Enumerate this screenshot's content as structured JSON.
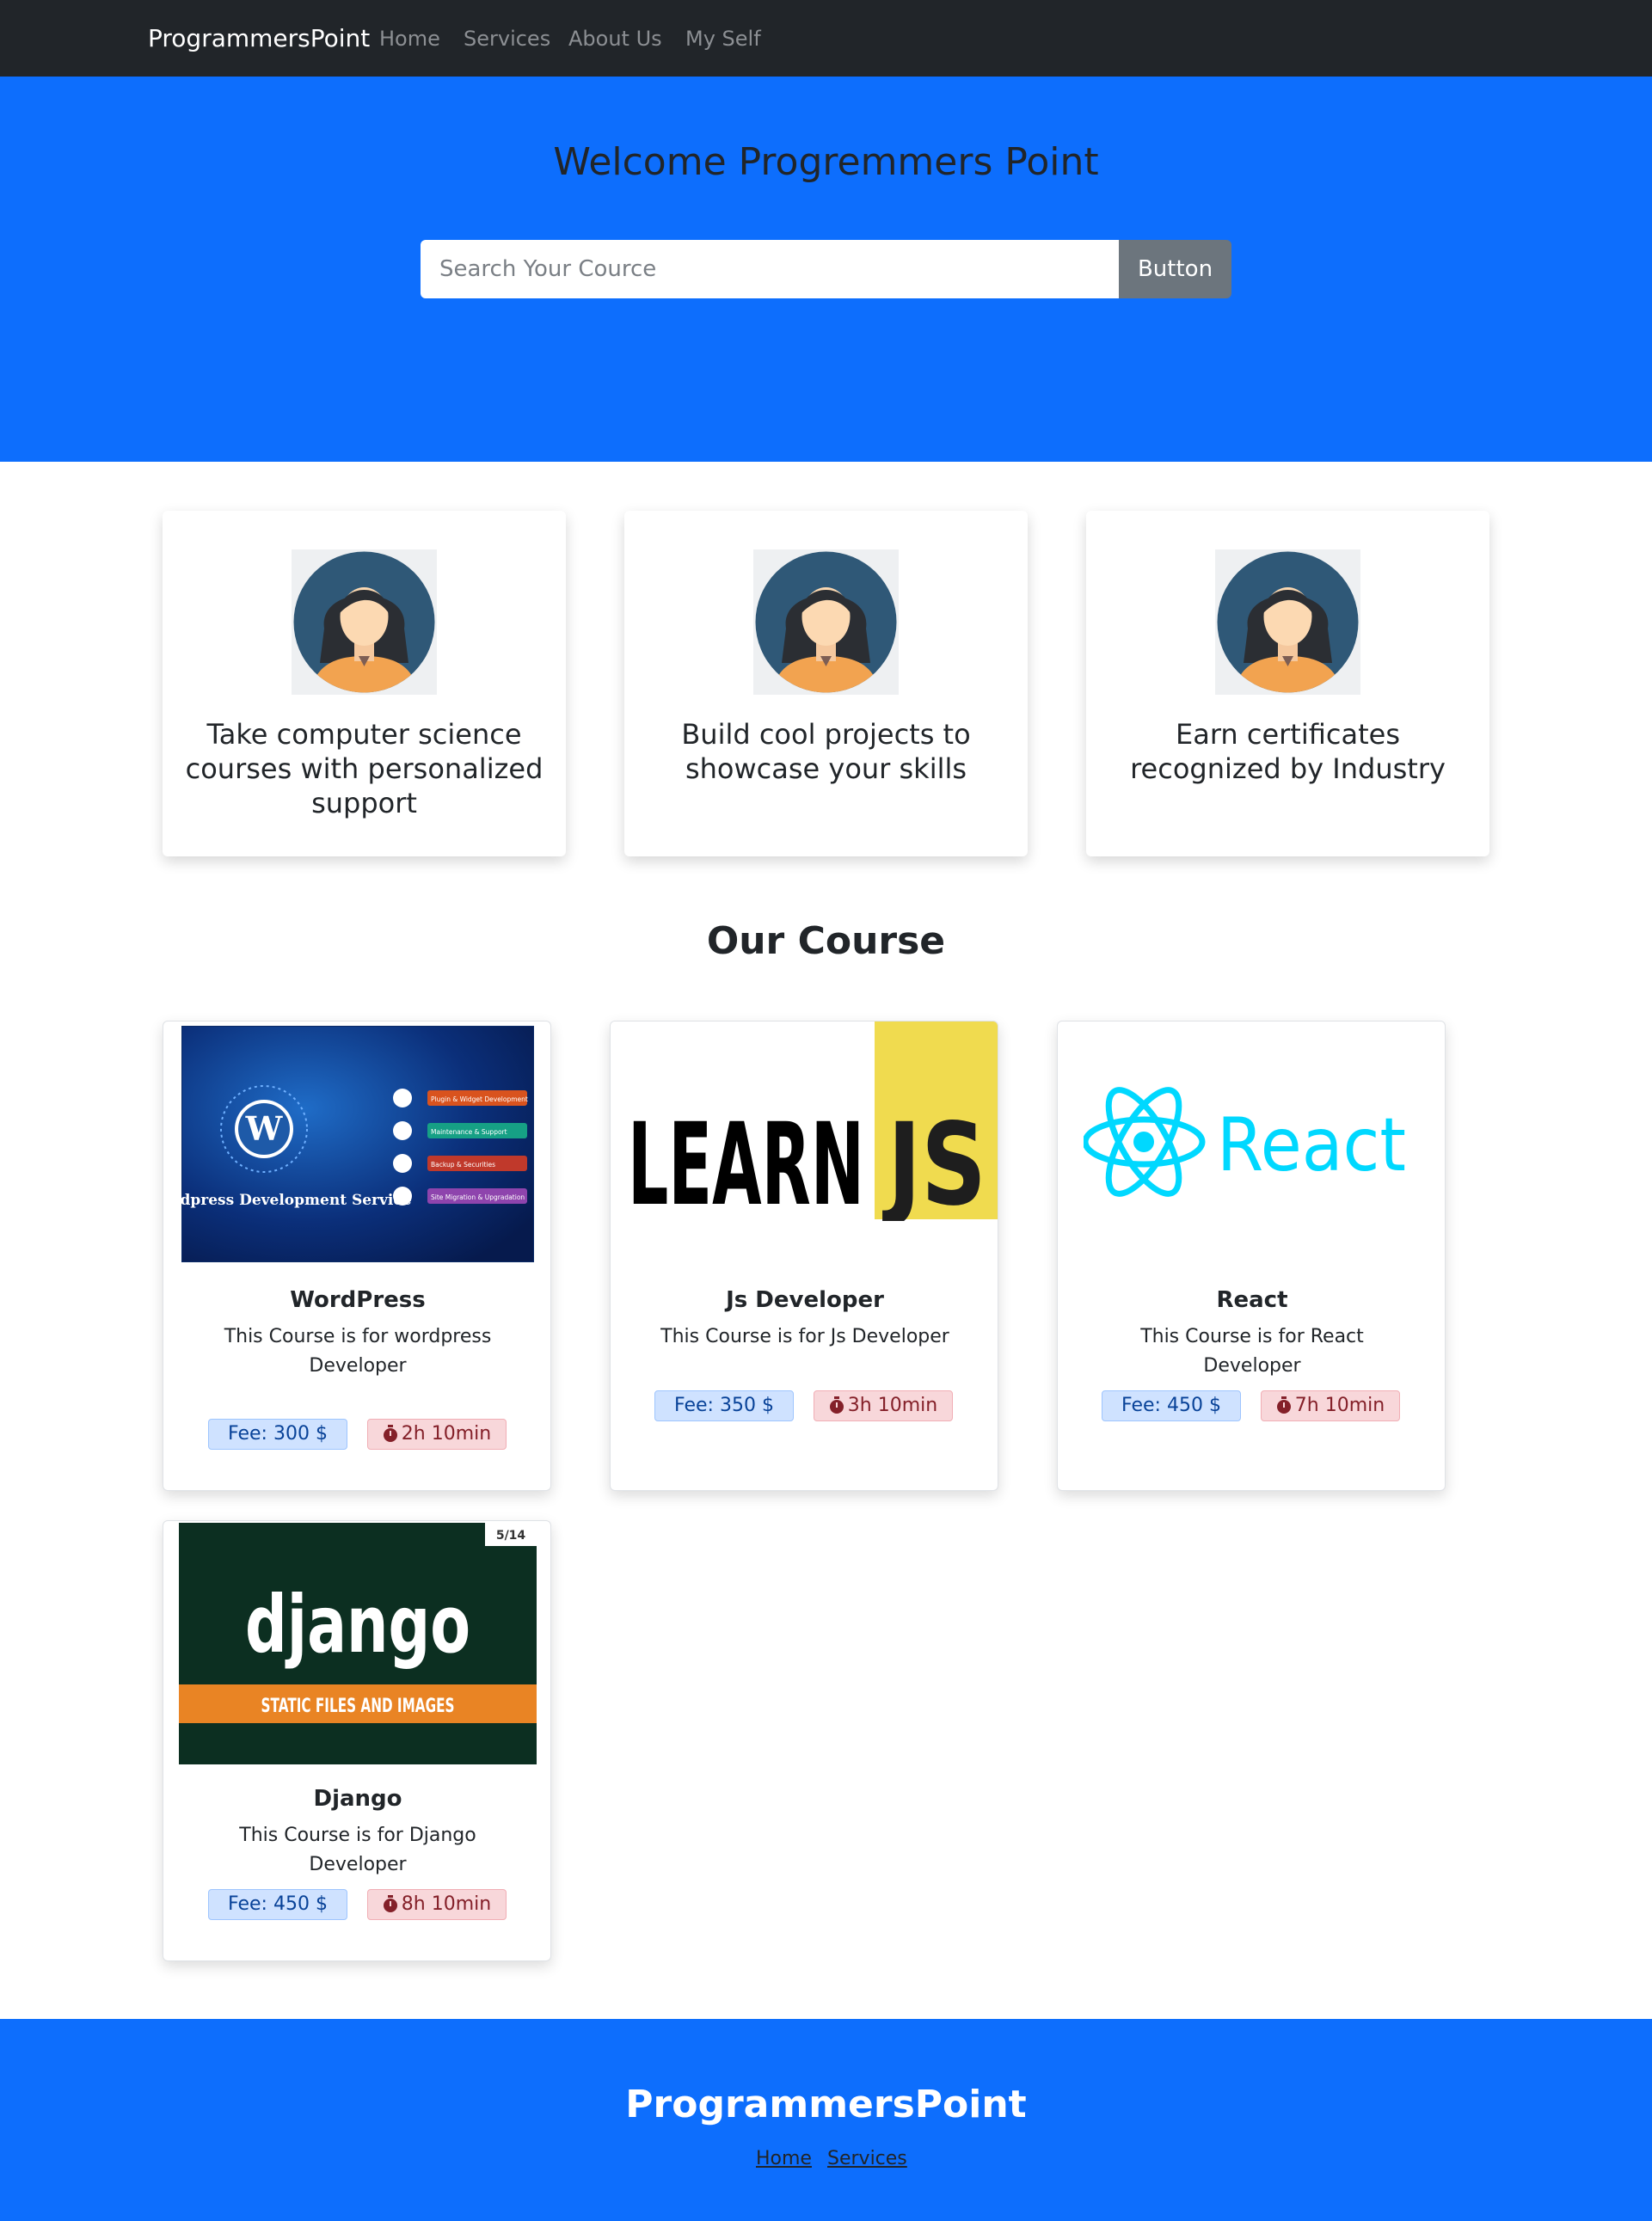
{
  "navbar": {
    "brand": "ProgrammersPoint",
    "links": [
      "Home",
      "Services",
      "About Us",
      "My Self"
    ]
  },
  "hero": {
    "title": "Welcome Progremmers Point",
    "search_placeholder": "Search Your Cource",
    "button_label": "Button"
  },
  "features": [
    {
      "text": "Take computer science courses with personalized support",
      "icon": "woman-avatar-icon"
    },
    {
      "text": "Build cool projects to showcase your skills",
      "icon": "woman-avatar-icon"
    },
    {
      "text": "Earn certificates recognized by Industry",
      "icon": "woman-avatar-icon"
    }
  ],
  "courses_section": {
    "title": "Our Course",
    "courses": [
      {
        "title": "WordPress",
        "description": "This Course is for wordpress Developer",
        "fee": "Fee: 300 $",
        "duration": "2h 10min",
        "image": {
          "heading": "Wordpress Development Service",
          "logo_letter": "W",
          "items": [
            "Plugin & Widget Development",
            "Maintenance & Support",
            "Backup & Securities",
            "Site Migration & Upgradation"
          ]
        }
      },
      {
        "title": "Js Developer",
        "description": "This Course is for Js Developer",
        "fee": "Fee: 350 $",
        "duration": "3h 10min",
        "image": {
          "word": "LEARN",
          "badge": "JS"
        }
      },
      {
        "title": "React",
        "description": "This Course is for React Developer",
        "fee": "Fee: 450 $",
        "duration": "7h 10min",
        "image": {
          "word": "React"
        }
      },
      {
        "title": "Django",
        "description": "This Course is for Django Developer",
        "fee": "Fee: 450 $",
        "duration": "8h 10min",
        "image": {
          "word": "django",
          "banner": "STATIC FILES AND IMAGES",
          "counter": "5/14"
        }
      }
    ]
  },
  "footer": {
    "brand": "ProgrammersPoint",
    "links": [
      "Home",
      "Services"
    ]
  },
  "colors": {
    "navbar": "#212529",
    "primary": "#0d6efd",
    "button_secondary": "#6c757d",
    "badge_fee_bg": "#cfe2ff",
    "badge_time_bg": "#f8d7da"
  }
}
